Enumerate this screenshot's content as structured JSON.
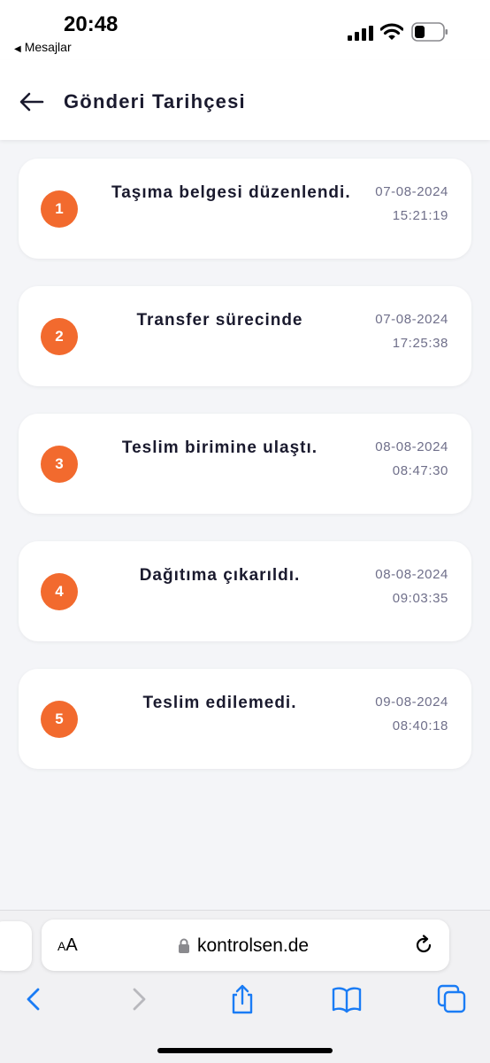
{
  "status_bar": {
    "time": "20:48",
    "back_app": "Mesajlar",
    "signal_icon": "cellular-signal-icon",
    "wifi_icon": "wifi-icon",
    "battery_icon": "battery-low-icon"
  },
  "header": {
    "title": "Gönderi Tarihçesi",
    "back_icon": "arrow-left-icon"
  },
  "history": [
    {
      "step": "1",
      "title": "Taşıma belgesi düzenlendi.",
      "date": "07-08-2024",
      "time": "15:21:19"
    },
    {
      "step": "2",
      "title": "Transfer sürecinde",
      "date": "07-08-2024",
      "time": "17:25:38"
    },
    {
      "step": "3",
      "title": "Teslim birimine ulaştı.",
      "date": "08-08-2024",
      "time": "08:47:30"
    },
    {
      "step": "4",
      "title": "Dağıtıma çıkarıldı.",
      "date": "08-08-2024",
      "time": "09:03:35"
    },
    {
      "step": "5",
      "title": "Teslim edilemedi.",
      "date": "09-08-2024",
      "time": "08:40:18"
    }
  ],
  "browser": {
    "text_size_label_small": "A",
    "text_size_label_large": "A",
    "url": "kontrolsen.de",
    "lock_icon": "lock-icon",
    "reload_icon": "reload-icon",
    "toolbar_icons": [
      "back-chevron-icon",
      "forward-chevron-icon",
      "share-icon",
      "bookmarks-icon",
      "tabs-icon"
    ]
  },
  "colors": {
    "accent": "#f26a2e",
    "title_text": "#1a1a2e",
    "muted_text": "#6f6f8a",
    "page_background": "#f4f5f8",
    "ios_blue": "#1a7cf5"
  }
}
